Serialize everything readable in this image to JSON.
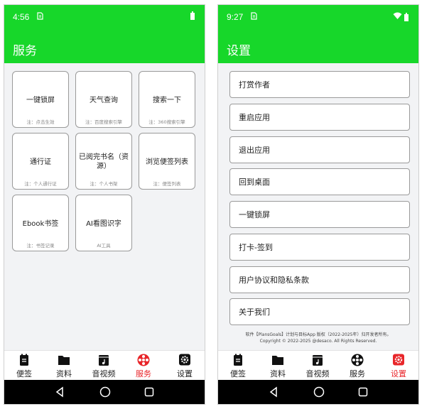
{
  "left": {
    "status": {
      "time": "4:56",
      "sim_icon": "sim-card-icon",
      "battery_icon": "battery-icon"
    },
    "title": "服务",
    "cards": [
      {
        "title": "一键锁屏",
        "note": "注：点击生效"
      },
      {
        "title": "天气查询",
        "note": "注：百度搜索引擎"
      },
      {
        "title": "搜索一下",
        "note": "注：360搜索引擎"
      },
      {
        "title": "通行证",
        "note": "注：个人通行证"
      },
      {
        "title": "已阅完书名（资源）",
        "note": "注：个人书架"
      },
      {
        "title": "浏览便签列表",
        "note": "注：便签列表"
      },
      {
        "title": "Ebook书签",
        "note": "注：书签记录"
      },
      {
        "title": "AI看图识字",
        "note": "AI工具"
      }
    ],
    "nav": [
      {
        "label": "便签",
        "icon": "memo-icon"
      },
      {
        "label": "资料",
        "icon": "folder-icon"
      },
      {
        "label": "音视频",
        "icon": "media-icon"
      },
      {
        "label": "服务",
        "icon": "services-icon"
      },
      {
        "label": "设置",
        "icon": "settings-icon"
      }
    ],
    "active_nav": "服务"
  },
  "right": {
    "status": {
      "time": "9:27",
      "sim_icon": "sim-card-icon",
      "wifi_icon": "wifi-icon",
      "battery_icon": "battery-icon"
    },
    "title": "设置",
    "items": [
      {
        "label": "打赏作者"
      },
      {
        "label": "重启应用"
      },
      {
        "label": "退出应用"
      },
      {
        "label": "回到桌面"
      },
      {
        "label": "一键锁屏"
      },
      {
        "label": "打卡-签到"
      },
      {
        "label": "用户协议和隐私条款"
      },
      {
        "label": "关于我们"
      }
    ],
    "copyright_line1": "软件【PlansGoals】计划与目标App 版权（2022-2025年）归开发者所有。",
    "copyright_line2": "Copyright © 2022-2025 @desaco. All Rights Reserved.",
    "nav": [
      {
        "label": "便签",
        "icon": "memo-icon"
      },
      {
        "label": "资料",
        "icon": "folder-icon"
      },
      {
        "label": "音视频",
        "icon": "media-icon"
      },
      {
        "label": "服务",
        "icon": "services-icon"
      },
      {
        "label": "设置",
        "icon": "settings-icon"
      }
    ],
    "active_nav": "设置"
  },
  "system_nav": {
    "back_icon": "back-triangle-icon",
    "home_icon": "home-circle-icon",
    "recents_icon": "recents-square-icon"
  },
  "colors": {
    "accent": "#17d72a",
    "active_nav": "#e8262a",
    "background": "#f2f3f5"
  }
}
